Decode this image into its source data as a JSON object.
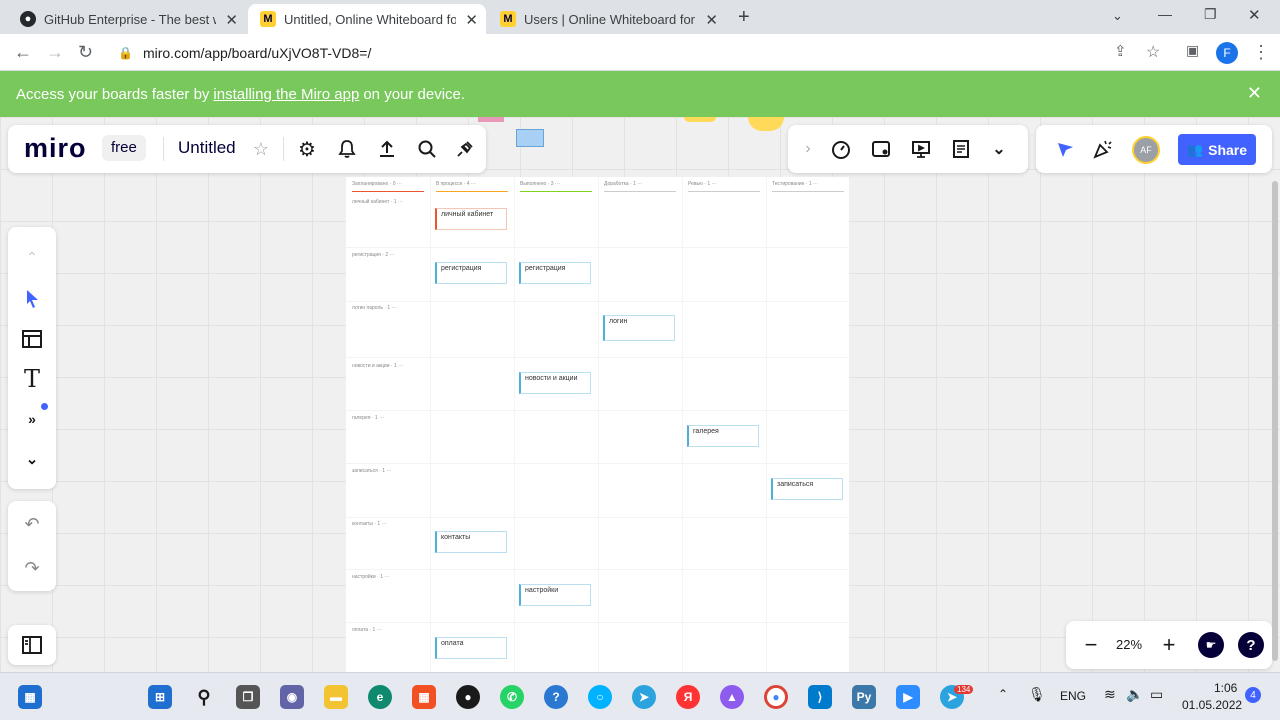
{
  "browser": {
    "tabs": [
      {
        "title": "GitHub Enterprise - The best way",
        "favicon": "github-icon",
        "active": false
      },
      {
        "title": "Untitled, Online Whiteboard for V",
        "favicon": "miro-icon",
        "active": true
      },
      {
        "title": "Users | Online Whiteboard for Vis",
        "favicon": "miro-icon",
        "active": false
      }
    ],
    "new_tab": "+",
    "url": "miro.com/app/board/uXjVO8T-VD8=/",
    "profile_initial": "F"
  },
  "banner": {
    "prefix": "Access your boards faster by",
    "link": "installing the Miro app",
    "suffix": "on your device."
  },
  "miro": {
    "logo": "miro",
    "plan": "free",
    "board_title": "Untitled",
    "share_label": "Share",
    "avatar_initials": "AF",
    "zoom": "22%",
    "help": "?"
  },
  "board": {
    "columns": [
      {
        "title": "Запланировано · 0 ···",
        "color": "#e8552f"
      },
      {
        "title": "В процессе · 4 ···",
        "color": "#f5a623"
      },
      {
        "title": "Выполнено · 3 ···",
        "color": "#7ed321"
      },
      {
        "title": "Доработка · 1 ···",
        "color": "#cccccc"
      },
      {
        "title": "Ревью · 1 ···",
        "color": "#cccccc"
      },
      {
        "title": "Тестирование · 1 ···",
        "color": "#cccccc"
      }
    ],
    "rows": [
      {
        "label": "личный кабинет · 1 ···",
        "cards": [
          {
            "col": 1,
            "text": "личный кабинет",
            "red": true
          }
        ]
      },
      {
        "label": "регистрация · 2 ···",
        "cards": [
          {
            "col": 1,
            "text": "регистрация"
          },
          {
            "col": 2,
            "text": "регистрация"
          }
        ]
      },
      {
        "label": "логин пароль · 1 ···",
        "cards": [
          {
            "col": 3,
            "text": "логин"
          }
        ]
      },
      {
        "label": "новости и акции · 1 ···",
        "cards": [
          {
            "col": 2,
            "text": "новости и акции"
          }
        ]
      },
      {
        "label": "галерея · 1 ···",
        "cards": [
          {
            "col": 4,
            "text": "галерея"
          }
        ]
      },
      {
        "label": "записаться · 1 ···",
        "cards": [
          {
            "col": 5,
            "text": "записаться"
          }
        ]
      },
      {
        "label": "контакты · 1 ···",
        "cards": [
          {
            "col": 1,
            "text": "контакты"
          }
        ]
      },
      {
        "label": "настройки · 1 ···",
        "cards": [
          {
            "col": 2,
            "text": "настройки"
          }
        ]
      },
      {
        "label": "оплата · 1 ···",
        "cards": [
          {
            "col": 1,
            "text": "оплата"
          }
        ]
      }
    ]
  },
  "taskbar": {
    "language": "ENG",
    "time": "1:06",
    "date": "01.05.2022",
    "notification_count": "4",
    "telegram_badge": "134"
  },
  "colors": {
    "banner": "#78c85c",
    "share": "#4262ff",
    "accent_dot": "#4262ff"
  }
}
